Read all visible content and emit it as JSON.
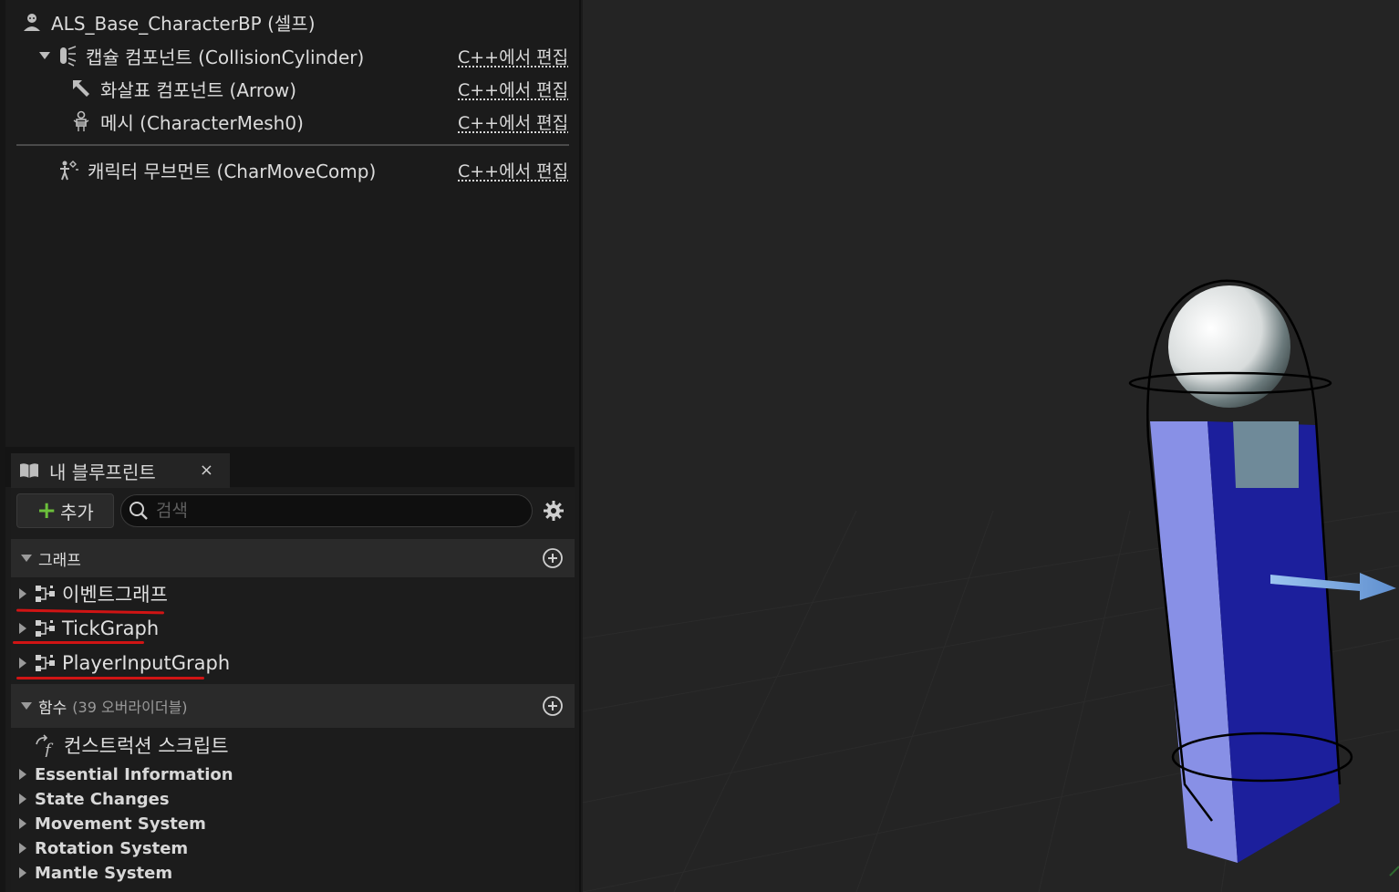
{
  "components": {
    "root": {
      "label": "ALS_Base_CharacterBP (셀프)"
    },
    "capsule": {
      "label": "캡슐 컴포넌트 (CollisionCylinder)",
      "edit": "C++에서 편집"
    },
    "arrow": {
      "label": "화살표 컴포넌트 (Arrow)",
      "edit": "C++에서 편집"
    },
    "mesh": {
      "label": "메시 (CharacterMesh0)",
      "edit": "C++에서 편집"
    },
    "movement": {
      "label": "캐릭터 무브먼트 (CharMoveComp)",
      "edit": "C++에서 편집"
    }
  },
  "my_blueprint": {
    "tab_label": "내 블루프린트",
    "close": "×",
    "add_label": "추가",
    "search_placeholder": "검색",
    "graphs_section": {
      "label": "그래프"
    },
    "graphs": [
      {
        "label": "이벤트그래프"
      },
      {
        "label": "TickGraph"
      },
      {
        "label": "PlayerInputGraph"
      }
    ],
    "functions_section": {
      "label": "함수",
      "count": "(39 오버라이더블)"
    },
    "construction_script": "컨스트럭션 스크립트",
    "categories": [
      {
        "label": "Essential Information"
      },
      {
        "label": "State Changes"
      },
      {
        "label": "Movement System"
      },
      {
        "label": "Rotation System"
      },
      {
        "label": "Mantle System"
      }
    ]
  },
  "colors": {
    "add_plus": "#6bbf3b",
    "annotation_red": "#d01414",
    "capsule_blue": "#1c1f9c",
    "arrow_blue": "#7aa6e0"
  },
  "icons": [
    "character-icon",
    "capsule-icon",
    "arrow-icon",
    "mesh-icon",
    "movement-icon",
    "blueprint-book-icon",
    "search-icon",
    "gear-icon",
    "graph-icon",
    "add-circle-icon",
    "function-icon"
  ]
}
